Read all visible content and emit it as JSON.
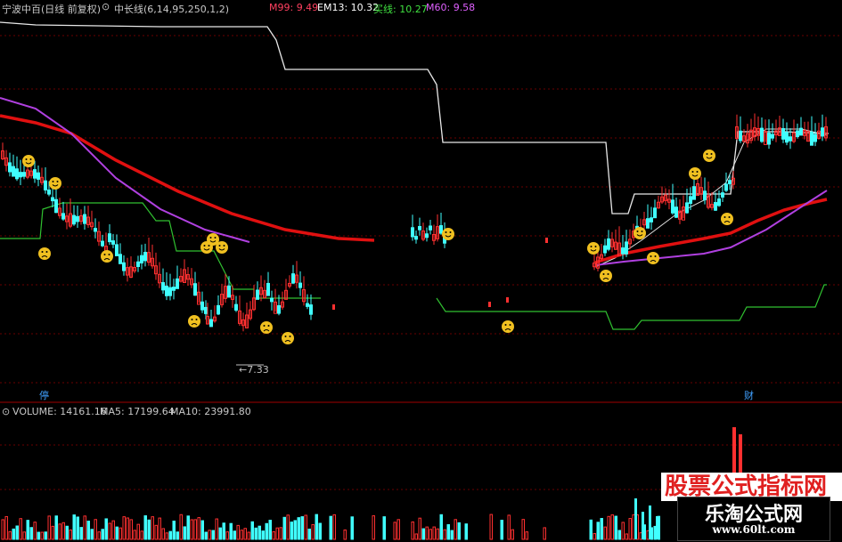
{
  "header": {
    "stock_title": "宁波中百(日线 前复权)",
    "indicator_title": "中长线(6,14,95,250,1,2)",
    "m99": "M99: 9.49",
    "em13": "EM13: 10.32",
    "buy_line": "买线: 10.27",
    "m60": "M60: 9.58"
  },
  "chart": {
    "low_price_label": "←7.33",
    "event_tag_left": "停",
    "event_tag_right": "财"
  },
  "volume": {
    "label": "VOLUME: 14161.16",
    "ma5": "MA5: 17199.64",
    "ma10": "MA10: 23991.80"
  },
  "watermark": {
    "top_text": "股票公式指标网",
    "main_text": "乐淘公式网",
    "url": "www.60lt.com"
  },
  "colors": {
    "background": "#000000",
    "grid": "#6a0000",
    "candle_up": "#ff3030",
    "candle_down": "#40ffff",
    "m99_line": "#e01010",
    "m60_line": "#b040e0",
    "buy_line": "#30c030",
    "em13_line": "#e8e8e8"
  }
}
